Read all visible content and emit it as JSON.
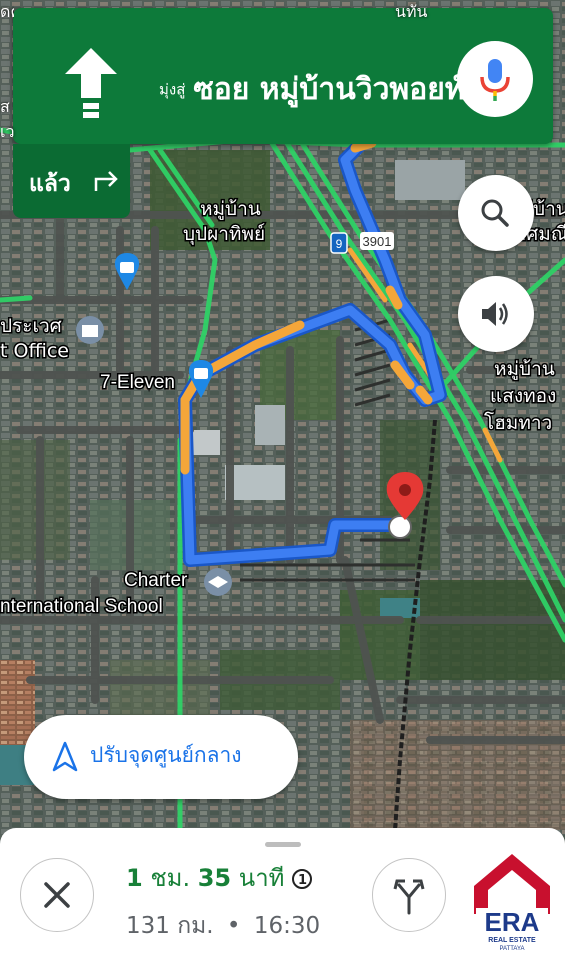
{
  "navigation": {
    "direction_prefix": "มุ่งสู่",
    "street_name": "ซอย หมู่บ้านวิวพอยท์",
    "then_label": "แล้ว",
    "then_icon": "turn-right-icon",
    "direction_icon": "straight-arrow-icon",
    "mic_icon": "mic-icon"
  },
  "map": {
    "labels": {
      "village_1a": "หมู่บ้าน",
      "village_1b": "บุปผาทิพย์",
      "village_2a": "หมู่บ้าน",
      "village_2b": "เลิศมณี",
      "village_3a": "หมู่บ้าน",
      "village_3b": "แสงทอง",
      "village_3c": "โฮมทาว",
      "post_office_a": "ประเวศ",
      "post_office_b": "t Office",
      "seven_eleven": "7-Eleven",
      "school_a": "Charter",
      "school_b": "nternational School",
      "route_shield": "9",
      "road_number": "3901",
      "top_fragment_1": "นทัน",
      "top_fragment_2": "ดคาร",
      "top_fragment_3": "ส",
      "top_fragment_4": "เว"
    },
    "colors": {
      "route": "#3d7ef2",
      "traffic_slow": "#f4a63a",
      "traffic_free": "#34c759",
      "destination_pin": "#e53935"
    }
  },
  "map_controls": {
    "search_icon": "search-icon",
    "sound_icon": "volume-icon"
  },
  "recenter": {
    "label": "ปรับจุดศูนย์กลาง",
    "icon": "navigation-arrow-icon"
  },
  "trip": {
    "hours": "1",
    "hours_unit": "ชม.",
    "minutes": "35",
    "minutes_unit": "นาที",
    "info_icon": "1",
    "distance": "131 กม.",
    "separator": "•",
    "arrival_time": "16:30"
  },
  "bottom_controls": {
    "close_icon": "close-icon",
    "alternate_routes_icon": "alt-route-icon"
  },
  "logo": {
    "brand": "ERA",
    "subtitle1": "REAL ESTATE",
    "subtitle2": "PATTAYA"
  }
}
